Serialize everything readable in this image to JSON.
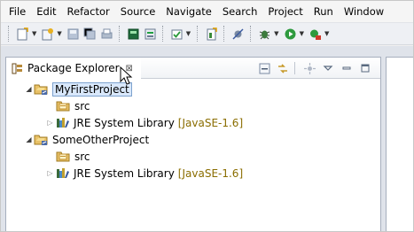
{
  "menu": [
    {
      "label": "File"
    },
    {
      "label": "Edit"
    },
    {
      "label": "Refactor"
    },
    {
      "label": "Source"
    },
    {
      "label": "Navigate"
    },
    {
      "label": "Search"
    },
    {
      "label": "Project"
    },
    {
      "label": "Run"
    },
    {
      "label": "Window"
    }
  ],
  "view": {
    "title": "Package Explorer",
    "close_glyph": "⊠"
  },
  "tree": [
    {
      "label": "MyFirstProject",
      "icon": "java-project-icon",
      "expanded": true,
      "selected": true
    },
    {
      "label": "src",
      "icon": "source-folder-icon"
    },
    {
      "label": "JRE System Library",
      "version": "[JavaSE-1.6]",
      "icon": "library-icon"
    },
    {
      "label": "SomeOtherProject",
      "icon": "java-project-icon",
      "expanded": true
    },
    {
      "label": "src",
      "icon": "source-folder-icon"
    },
    {
      "label": "JRE System Library",
      "version": "[JavaSE-1.6]",
      "icon": "library-icon"
    }
  ],
  "colors": {
    "selection_bg": "#d9e8fb",
    "selection_border": "#7da2ce",
    "version_text": "#8a6d00"
  }
}
